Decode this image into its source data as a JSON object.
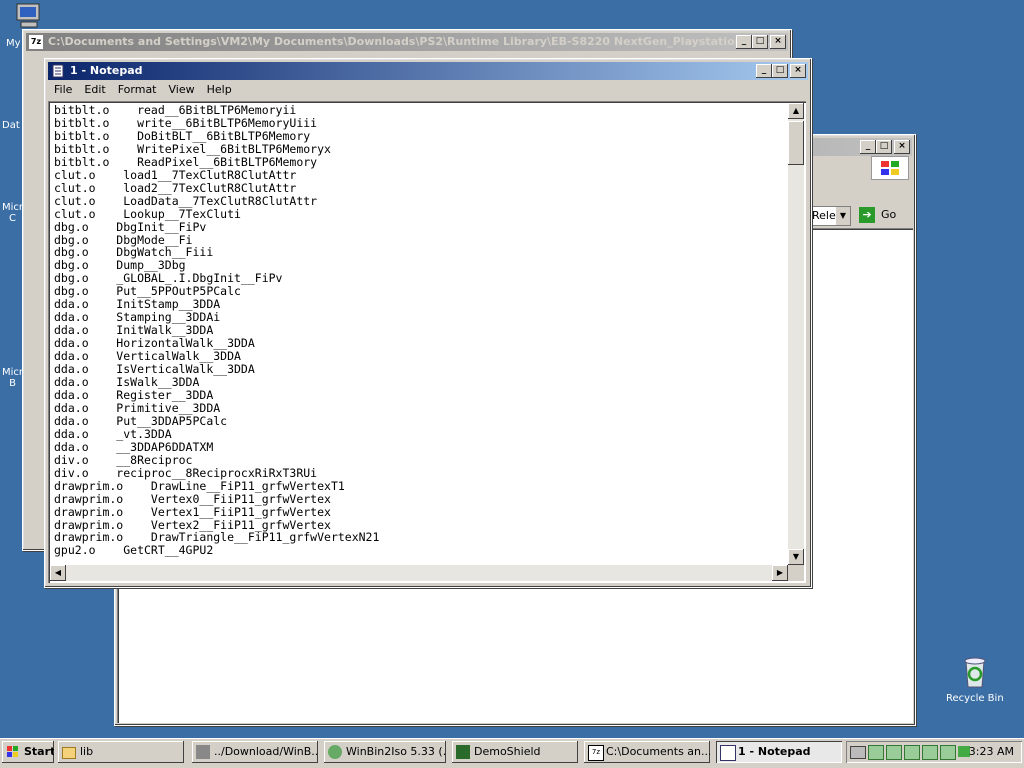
{
  "desktop": {
    "icons": [
      {
        "name": "my-computer",
        "label": "My"
      },
      {
        "name": "data",
        "label": "Dat"
      },
      {
        "name": "microsoft1",
        "label": "Micr\nC"
      },
      {
        "name": "microsoft2",
        "label": "Micr\nB"
      },
      {
        "name": "recycle-bin",
        "label": "Recycle Bin"
      }
    ]
  },
  "bg_window": {
    "title": "C:\\Documents and Settings\\VM2\\My Documents\\Downloads\\PS2\\Runtime Library\\EB-S8220 NextGen_Playstation_(G..."
  },
  "explorer_window": {
    "dropdown_value": "Relea",
    "go_label": "Go"
  },
  "notepad": {
    "title": "1 - Notepad",
    "menu": [
      "File",
      "Edit",
      "Format",
      "View",
      "Help"
    ],
    "lines": [
      "bitblt.o    read__6BitBLTP6Memoryii",
      "bitblt.o    write__6BitBLTP6MemoryUiii",
      "bitblt.o    DoBitBLT__6BitBLTP6Memory",
      "bitblt.o    WritePixel__6BitBLTP6Memoryx",
      "bitblt.o    ReadPixel__6BitBLTP6Memory",
      "clut.o    load1__7TexClutR8ClutAttr",
      "clut.o    load2__7TexClutR8ClutAttr",
      "clut.o    LoadData__7TexClutR8ClutAttr",
      "clut.o    Lookup__7TexCluti",
      "dbg.o    DbgInit__FiPv",
      "dbg.o    DbgMode__Fi",
      "dbg.o    DbgWatch__Fiii",
      "dbg.o    Dump__3Dbg",
      "dbg.o    _GLOBAL_.I.DbgInit__FiPv",
      "dbg.o    Put__5PPOutP5PCalc",
      "dda.o    InitStamp__3DDA",
      "dda.o    Stamping__3DDAi",
      "dda.o    InitWalk__3DDA",
      "dda.o    HorizontalWalk__3DDA",
      "dda.o    VerticalWalk__3DDA",
      "dda.o    IsVerticalWalk__3DDA",
      "dda.o    IsWalk__3DDA",
      "dda.o    Register__3DDA",
      "dda.o    Primitive__3DDA",
      "dda.o    Put__3DDAP5PCalc",
      "dda.o    _vt.3DDA",
      "dda.o    __3DDAP6DDATXM",
      "div.o    __8Reciproc",
      "div.o    reciproc__8ReciprocxRiRxT3RUi",
      "drawprim.o    DrawLine__FiP11_grfwVertexT1",
      "drawprim.o    Vertex0__FiiP11_grfwVertex",
      "drawprim.o    Vertex1__FiiP11_grfwVertex",
      "drawprim.o    Vertex2__FiiP11_grfwVertex",
      "drawprim.o    DrawTriangle__FiP11_grfwVertexN21",
      "gpu2.o    GetCRT__4GPU2"
    ]
  },
  "taskbar": {
    "start_label": "Start",
    "tasks": [
      {
        "label": "lib"
      },
      {
        "label": "../Download/WinB..."
      },
      {
        "label": "WinBin2Iso 5.33 (..."
      },
      {
        "label": "DemoShield"
      },
      {
        "label": "C:\\Documents an..."
      },
      {
        "label": "1 - Notepad"
      }
    ],
    "clock": "3:23 AM"
  }
}
